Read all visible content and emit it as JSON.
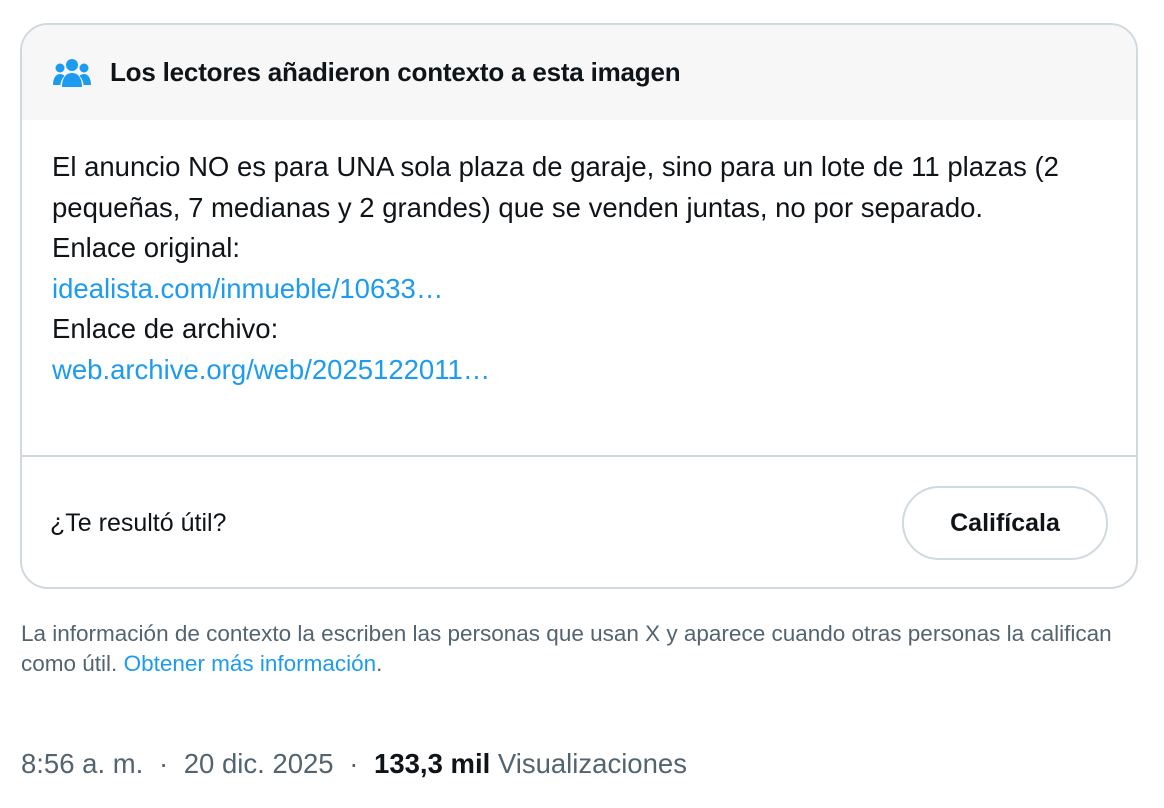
{
  "note": {
    "title": "Los lectores añadieron contexto a esta imagen",
    "header_icon": "people-icon",
    "body_text": "El anuncio NO es para UNA sola plaza de garaje, sino para un lote de 11 plazas (2 pequeñas, 7 medianas y 2 grandes) que se venden juntas, no por separado.",
    "original_label": "Enlace original:",
    "original_link": "idealista.com/inmueble/10633…",
    "archive_label": "Enlace de archivo:",
    "archive_link": "web.archive.org/web/2025122011…",
    "helpful_question": "¿Te resultó útil?",
    "rate_button": "Califícala"
  },
  "disclaimer": {
    "text": "La información de contexto la escriben las personas que usan X y aparece cuando otras personas la califican como útil.",
    "link": "Obtener más información",
    "end": "."
  },
  "meta": {
    "time": "8:56 a. m.",
    "date_sep": "·",
    "date": "20 dic. 2025",
    "views_sep": "·",
    "views_count": "133,3 mil",
    "views_label": "Visualizaciones"
  },
  "colors": {
    "accent": "#1d9bf0",
    "text": "#0f1419",
    "secondary_text": "#536471",
    "border": "#cfd9de",
    "header_bg": "#f7f7f7"
  }
}
